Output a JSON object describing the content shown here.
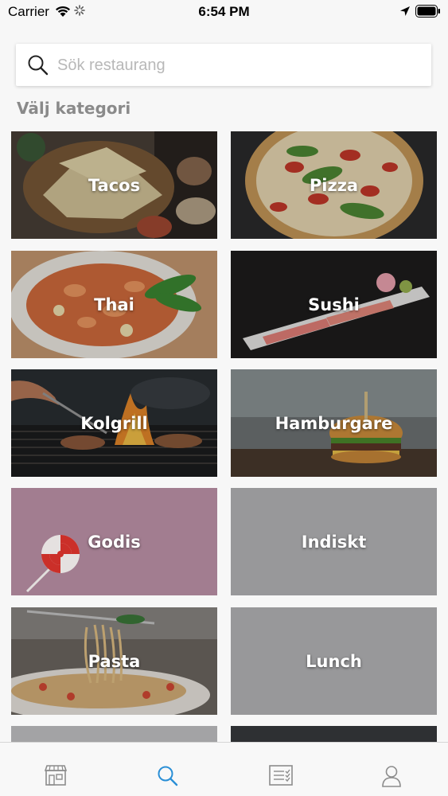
{
  "status_bar": {
    "carrier": "Carrier",
    "time": "6:54 PM"
  },
  "search": {
    "placeholder": "Sök restaurang",
    "value": ""
  },
  "section_title": "Välj kategori",
  "categories": [
    {
      "label": "Tacos",
      "icon": "tacos-photo"
    },
    {
      "label": "Pizza",
      "icon": "pizza-photo"
    },
    {
      "label": "Thai",
      "icon": "thai-photo"
    },
    {
      "label": "Sushi",
      "icon": "sushi-photo"
    },
    {
      "label": "Kolgrill",
      "icon": "grill-photo"
    },
    {
      "label": "Hamburgare",
      "icon": "burger-photo"
    },
    {
      "label": "Godis",
      "icon": "lollipop-photo"
    },
    {
      "label": "Indiskt",
      "icon": "grey-placeholder"
    },
    {
      "label": "Pasta",
      "icon": "pasta-photo"
    },
    {
      "label": "Lunch",
      "icon": "grey-placeholder"
    }
  ],
  "tab_bar": {
    "active": "search",
    "tabs": [
      "restaurants-icon",
      "search-icon",
      "orders-icon",
      "profile-icon"
    ]
  },
  "colors": {
    "accent": "#2a8fd6",
    "tab_inactive": "#8c8c8c",
    "placeholder_tile": "#98989a",
    "godis_tile": "#a67c91"
  }
}
